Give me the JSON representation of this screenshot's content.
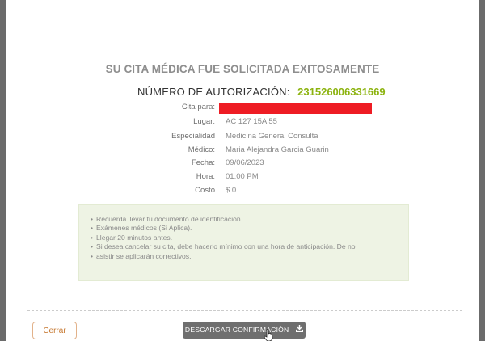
{
  "headline": "SU CITA MÉDICA FUE SOLICITADA EXITOSAMENTE",
  "authorization": {
    "label": "NÚMERO DE AUTORIZACIÓN:",
    "value": "231526006331669"
  },
  "details": {
    "cita_para_label": "Cita para:",
    "lugar_label": "Lugar:",
    "lugar_value": "AC 127 15A 55",
    "especialidad_label": "Especialidad",
    "especialidad_value": "Medicina General Consulta",
    "medico_label": "Médico:",
    "medico_value": "Maria Alejandra Garcia Guarin",
    "fecha_label": "Fecha:",
    "fecha_value": "09/06/2023",
    "hora_label": "Hora:",
    "hora_value": "01:00 PM",
    "costo_label": "Costo",
    "costo_value": "$ 0"
  },
  "notes": [
    "Recuerda llevar tu documento de identificación.",
    "Exámenes médicos (Si Aplica).",
    "Llegar 20 minutos antes.",
    "Si desea cancelar su cita, debe hacerlo mínimo con una hora de anticipación. De no",
    "asistir se aplicarán correctivos."
  ],
  "buttons": {
    "close_label": "Cerrar",
    "download_label": "DESCARGAR CONFIRMACIÓN"
  },
  "colors": {
    "accent_green": "#8cb30f",
    "redaction": "#ee1c24",
    "close_border": "#e2b28a"
  }
}
